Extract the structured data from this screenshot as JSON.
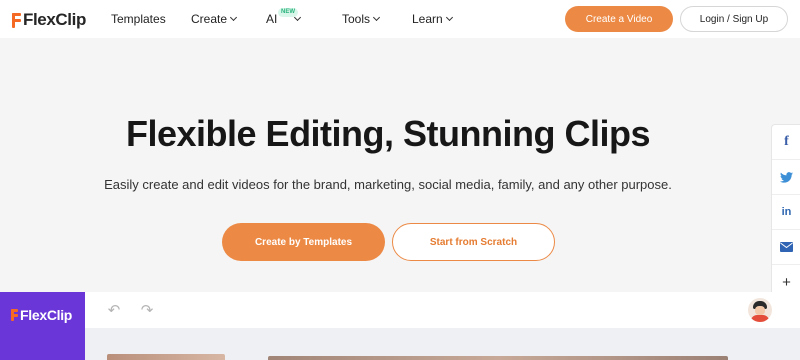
{
  "header": {
    "logo_text": "FlexClip",
    "nav": [
      {
        "label": "Templates",
        "has_dropdown": false
      },
      {
        "label": "Create",
        "has_dropdown": true
      },
      {
        "label": "AI",
        "has_dropdown": true,
        "badge": "NEW"
      },
      {
        "label": "Tools",
        "has_dropdown": true
      },
      {
        "label": "Learn",
        "has_dropdown": true
      }
    ],
    "create_video_label": "Create a Video",
    "login_label": "Login / Sign Up"
  },
  "hero": {
    "title": "Flexible Editing, Stunning Clips",
    "subtitle": "Easily create and edit videos for the brand, marketing, social media, family, and any other purpose.",
    "primary_button": "Create by Templates",
    "secondary_button": "Start from Scratch"
  },
  "share_rail": {
    "items": [
      "facebook-icon",
      "twitter-icon",
      "linkedin-icon",
      "mail-icon",
      "plus-icon"
    ],
    "facebook_glyph": "f",
    "linkedin_glyph": "in",
    "plus_glyph": "+"
  },
  "editor_preview": {
    "logo_text": "FlexClip",
    "undo_glyph": "↶",
    "redo_glyph": "↷"
  },
  "colors": {
    "accent": "#ec8a45",
    "logo_orange": "#f46a25",
    "editor_sidebar": "#6a36d8",
    "badge_green": "#2ab37c"
  }
}
